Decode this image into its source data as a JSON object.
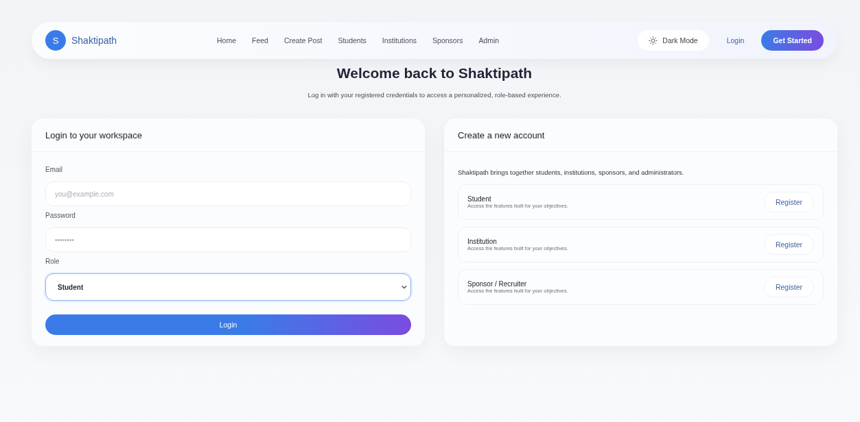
{
  "navbar": {
    "logo_letter": "S",
    "brand": "Shaktipath",
    "links": [
      "Home",
      "Feed",
      "Create Post",
      "Students",
      "Institutions",
      "Sponsors",
      "Admin"
    ],
    "theme_toggle": "Dark Mode",
    "login": "Login",
    "cta": "Get Started"
  },
  "heading": {
    "title": "Welcome back to Shaktipath",
    "subtitle": "Log in with your registered credentials to access a personalized, role-based experience."
  },
  "login_card": {
    "title": "Login to your workspace",
    "fields": [
      {
        "kind": "input",
        "label": "Email",
        "placeholder": "you@example.com",
        "focused": false
      },
      {
        "kind": "input",
        "label": "Password",
        "placeholder": "••••••••",
        "focused": false
      },
      {
        "kind": "select",
        "label": "Role",
        "value": "Student",
        "focused": true
      }
    ],
    "submit": "Login"
  },
  "register_card": {
    "title": "Create a new account",
    "intro": "Shaktipath brings together students, institutions, sponsors, and administrators.",
    "roles": [
      {
        "name": "Student",
        "description": "Access the features built for your objectives.",
        "action": "Register"
      },
      {
        "name": "Institution",
        "description": "Access the features built for your objectives.",
        "action": "Register"
      },
      {
        "name": "Sponsor / Recruiter",
        "description": "Access the features built for your objectives.",
        "action": "Register"
      }
    ]
  }
}
